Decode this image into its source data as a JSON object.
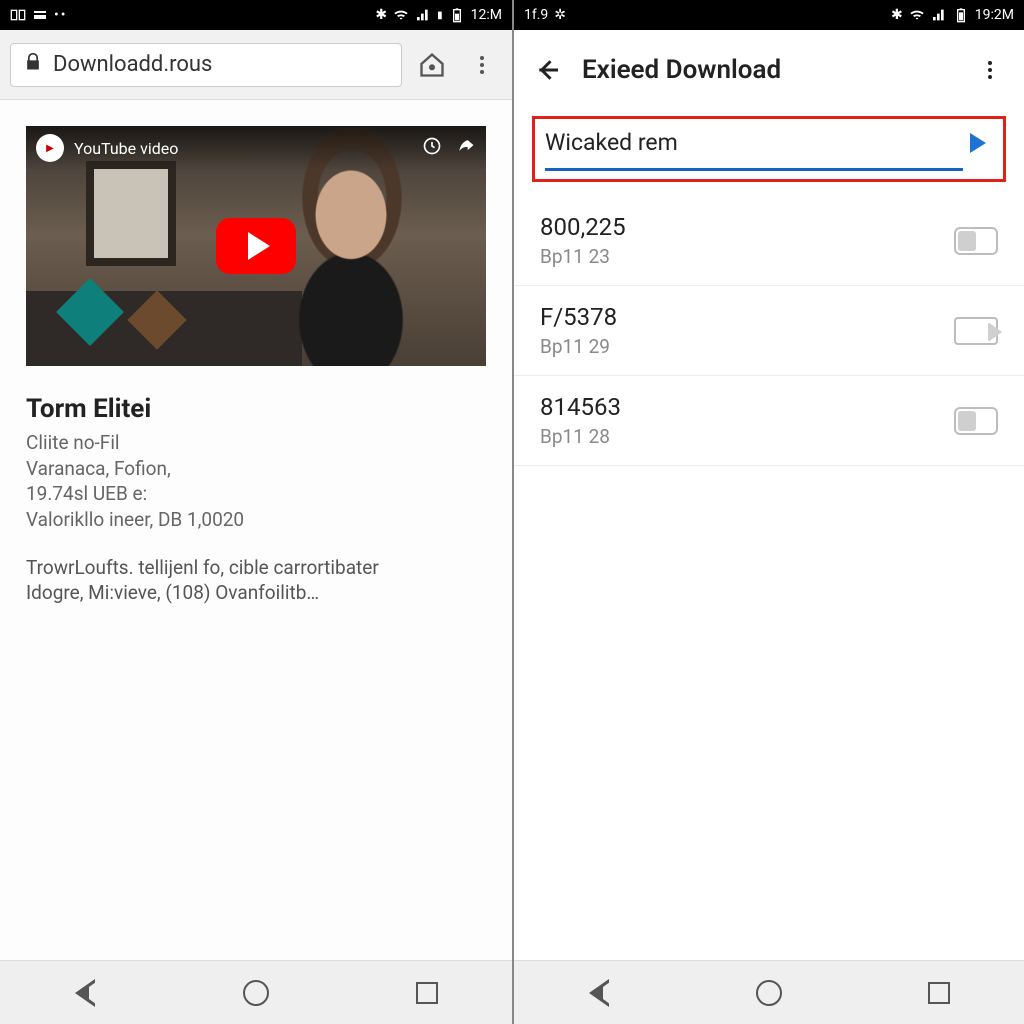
{
  "left": {
    "status": {
      "time": "12:M",
      "left_text": ""
    },
    "url": "Downloadd.rous",
    "yt_label": "YouTube video",
    "video_title": "Torm Elitei",
    "meta_lines": [
      "Cliite no-Fil",
      "Varanaca, Fofion,",
      "19.74sl UEB e:",
      "Valorikllo ineer, DB 1,0020"
    ],
    "desc_lines": [
      "TrowrLoufts. tellijenl fo, cible carrortibater",
      "Idogre, Mi:vieve, (108) Ovanfoilitb…"
    ]
  },
  "right": {
    "status": {
      "left_text": "1f.9",
      "time": "19:2M"
    },
    "app_title": "Exieed Download",
    "search_text": "Wicaked rem",
    "items": [
      {
        "title": "800,225",
        "sub": "Bp11 23"
      },
      {
        "title": "F/5378",
        "sub": "Bp11 29"
      },
      {
        "title": "814563",
        "sub": "Bp11 28"
      }
    ]
  }
}
